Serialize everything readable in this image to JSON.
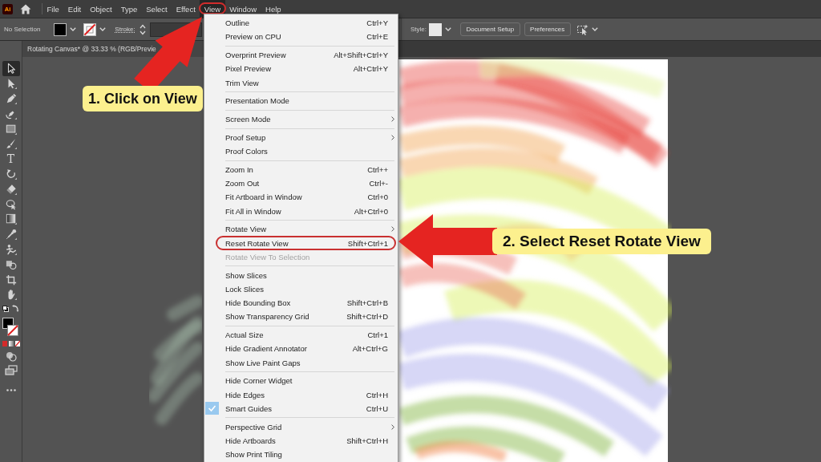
{
  "menu_bar": {
    "logo": "Ai",
    "items": [
      {
        "label": "File",
        "selected": false,
        "circled": false
      },
      {
        "label": "Edit",
        "selected": false,
        "circled": false
      },
      {
        "label": "Object",
        "selected": false,
        "circled": false
      },
      {
        "label": "Type",
        "selected": false,
        "circled": false
      },
      {
        "label": "Select",
        "selected": false,
        "circled": false
      },
      {
        "label": "Effect",
        "selected": false,
        "circled": false
      },
      {
        "label": "View",
        "selected": true,
        "circled": true
      },
      {
        "label": "Window",
        "selected": false,
        "circled": false
      },
      {
        "label": "Help",
        "selected": false,
        "circled": false
      }
    ]
  },
  "control_bar": {
    "selection_status": "No Selection",
    "stroke_label": "Stroke:",
    "style_label": "Style:",
    "buttons": [
      "Document Setup",
      "Preferences"
    ]
  },
  "document_tab": {
    "title": "Rotating Canvas* @ 33.33 % (RGB/Previe"
  },
  "toolbar": {
    "tools": [
      {
        "kind": "selection",
        "selected": true
      },
      {
        "kind": "direct-selection",
        "selected": false
      },
      {
        "kind": "pen",
        "selected": false
      },
      {
        "kind": "curvature",
        "selected": false
      },
      {
        "kind": "rectangle",
        "selected": false
      },
      {
        "kind": "paintbrush",
        "selected": false
      },
      {
        "kind": "type",
        "glyph": "T",
        "selected": false
      },
      {
        "kind": "rotate",
        "selected": false
      },
      {
        "kind": "eraser",
        "selected": false
      },
      {
        "kind": "shape-builder",
        "selected": false
      },
      {
        "kind": "gradient",
        "selected": false
      },
      {
        "kind": "eyedropper",
        "selected": false
      },
      {
        "kind": "puppet-warp",
        "selected": false
      },
      {
        "kind": "blend",
        "selected": false
      },
      {
        "kind": "artboard",
        "selected": false
      },
      {
        "kind": "hand",
        "selected": false
      }
    ]
  },
  "view_menu": {
    "groups": [
      [
        {
          "label": "Outline",
          "shortcut": "Ctrl+Y",
          "submenu": false,
          "checked": false,
          "disabled": false,
          "circled": false
        },
        {
          "label": "Preview on CPU",
          "shortcut": "Ctrl+E",
          "submenu": false,
          "checked": false,
          "disabled": false,
          "circled": false
        }
      ],
      [
        {
          "label": "Overprint Preview",
          "shortcut": "Alt+Shift+Ctrl+Y",
          "submenu": false,
          "checked": false,
          "disabled": false,
          "circled": false
        },
        {
          "label": "Pixel Preview",
          "shortcut": "Alt+Ctrl+Y",
          "submenu": false,
          "checked": false,
          "disabled": false,
          "circled": false
        },
        {
          "label": "Trim View",
          "submenu": false,
          "checked": false,
          "disabled": false,
          "circled": false
        }
      ],
      [
        {
          "label": "Presentation Mode",
          "submenu": false,
          "checked": false,
          "disabled": false,
          "circled": false
        }
      ],
      [
        {
          "label": "Screen Mode",
          "submenu": true,
          "checked": false,
          "disabled": false,
          "circled": false
        }
      ],
      [
        {
          "label": "Proof Setup",
          "submenu": true,
          "checked": false,
          "disabled": false,
          "circled": false
        },
        {
          "label": "Proof Colors",
          "submenu": false,
          "checked": false,
          "disabled": false,
          "circled": false
        }
      ],
      [
        {
          "label": "Zoom In",
          "shortcut": "Ctrl++",
          "submenu": false,
          "checked": false,
          "disabled": false,
          "circled": false
        },
        {
          "label": "Zoom Out",
          "shortcut": "Ctrl+-",
          "submenu": false,
          "checked": false,
          "disabled": false,
          "circled": false
        },
        {
          "label": "Fit Artboard in Window",
          "shortcut": "Ctrl+0",
          "submenu": false,
          "checked": false,
          "disabled": false,
          "circled": false
        },
        {
          "label": "Fit All in Window",
          "shortcut": "Alt+Ctrl+0",
          "submenu": false,
          "checked": false,
          "disabled": false,
          "circled": false
        }
      ],
      [
        {
          "label": "Rotate View",
          "submenu": true,
          "checked": false,
          "disabled": false,
          "circled": false
        },
        {
          "label": "Reset Rotate View",
          "shortcut": "Shift+Ctrl+1",
          "submenu": false,
          "checked": false,
          "disabled": false,
          "circled": true
        },
        {
          "label": "Rotate View To Selection",
          "submenu": false,
          "checked": false,
          "disabled": true,
          "circled": false
        }
      ],
      [
        {
          "label": "Show Slices",
          "submenu": false,
          "checked": false,
          "disabled": false,
          "circled": false
        },
        {
          "label": "Lock Slices",
          "submenu": false,
          "checked": false,
          "disabled": false,
          "circled": false
        },
        {
          "label": "Hide Bounding Box",
          "shortcut": "Shift+Ctrl+B",
          "submenu": false,
          "checked": false,
          "disabled": false,
          "circled": false
        },
        {
          "label": "Show Transparency Grid",
          "shortcut": "Shift+Ctrl+D",
          "submenu": false,
          "checked": false,
          "disabled": false,
          "circled": false
        }
      ],
      [
        {
          "label": "Actual Size",
          "shortcut": "Ctrl+1",
          "submenu": false,
          "checked": false,
          "disabled": false,
          "circled": false
        },
        {
          "label": "Hide Gradient Annotator",
          "shortcut": "Alt+Ctrl+G",
          "submenu": false,
          "checked": false,
          "disabled": false,
          "circled": false
        },
        {
          "label": "Show Live Paint Gaps",
          "submenu": false,
          "checked": false,
          "disabled": false,
          "circled": false
        }
      ],
      [
        {
          "label": "Hide Corner Widget",
          "submenu": false,
          "checked": false,
          "disabled": false,
          "circled": false
        },
        {
          "label": "Hide Edges",
          "shortcut": "Ctrl+H",
          "submenu": false,
          "checked": false,
          "disabled": false,
          "circled": false
        },
        {
          "label": "Smart Guides",
          "shortcut": "Ctrl+U",
          "submenu": false,
          "checked": true,
          "disabled": false,
          "circled": false
        }
      ],
      [
        {
          "label": "Perspective Grid",
          "submenu": true,
          "checked": false,
          "disabled": false,
          "circled": false
        },
        {
          "label": "Hide Artboards",
          "shortcut": "Shift+Ctrl+H",
          "submenu": false,
          "checked": false,
          "disabled": false,
          "circled": false
        },
        {
          "label": "Show Print Tiling",
          "submenu": false,
          "checked": false,
          "disabled": false,
          "circled": false
        }
      ]
    ]
  },
  "callouts": [
    {
      "text": "1. Click on View"
    },
    {
      "text": "2. Select Reset Rotate View"
    }
  ]
}
